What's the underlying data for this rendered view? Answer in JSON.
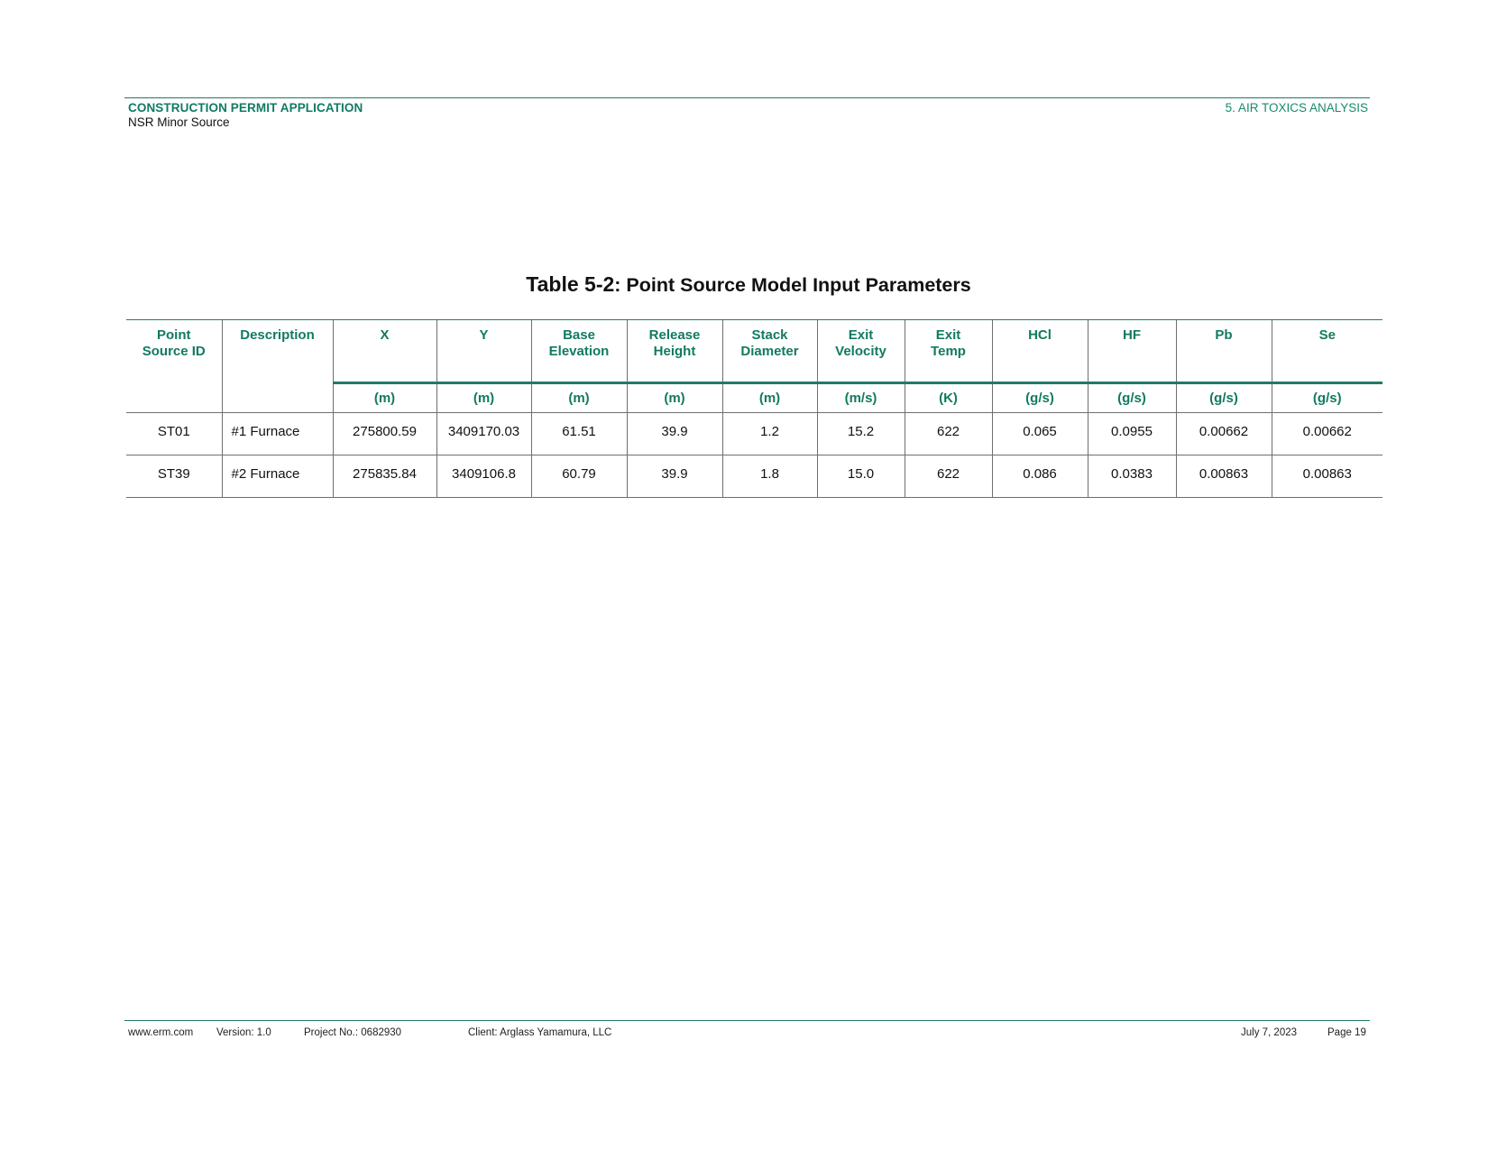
{
  "header": {
    "left_title": "CONSTRUCTION PERMIT APPLICATION",
    "left_subtitle": "NSR Minor Source",
    "right_section": "5. AIR TOXICS ANALYSIS"
  },
  "table": {
    "title_number": "Table 5-2",
    "title_text": ": Point Source Model Input Parameters",
    "columns": [
      {
        "label_line1": "Point",
        "label_line2": "Source ID",
        "unit": ""
      },
      {
        "label_line1": "Description",
        "label_line2": "",
        "unit": ""
      },
      {
        "label_line1": "X",
        "label_line2": "",
        "unit": "(m)"
      },
      {
        "label_line1": "Y",
        "label_line2": "",
        "unit": "(m)"
      },
      {
        "label_line1": "Base",
        "label_line2": "Elevation",
        "unit": "(m)"
      },
      {
        "label_line1": "Release",
        "label_line2": "Height",
        "unit": "(m)"
      },
      {
        "label_line1": "Stack",
        "label_line2": "Diameter",
        "unit": "(m)"
      },
      {
        "label_line1": "Exit",
        "label_line2": "Velocity",
        "unit": "(m/s)"
      },
      {
        "label_line1": "Exit",
        "label_line2": "Temp",
        "unit": "(K)"
      },
      {
        "label_line1": "HCl",
        "label_line2": "",
        "unit": "(g/s)"
      },
      {
        "label_line1": "HF",
        "label_line2": "",
        "unit": "(g/s)"
      },
      {
        "label_line1": "Pb",
        "label_line2": "",
        "unit": "(g/s)"
      },
      {
        "label_line1": "Se",
        "label_line2": "",
        "unit": "(g/s)"
      }
    ],
    "rows": [
      [
        "ST01",
        "#1 Furnace",
        "275800.59",
        "3409170.03",
        "61.51",
        "39.9",
        "1.2",
        "15.2",
        "622",
        "0.065",
        "0.0955",
        "0.00662",
        "0.00662"
      ],
      [
        "ST39",
        "#2 Furnace",
        "275835.84",
        "3409106.8",
        "60.79",
        "39.9",
        "1.8",
        "15.0",
        "622",
        "0.086",
        "0.0383",
        "0.00863",
        "0.00863"
      ]
    ]
  },
  "footer": {
    "website": "www.erm.com",
    "version": "Version: 1.0",
    "project": "Project No.: 0682930",
    "client": "Client: Arglass Yamamura, LLC",
    "date": "July 7, 2023",
    "page": "Page 19"
  },
  "colors": {
    "accent": "#0f7b63",
    "rule": "#1f7a68",
    "grid": "#6f6f6f"
  }
}
